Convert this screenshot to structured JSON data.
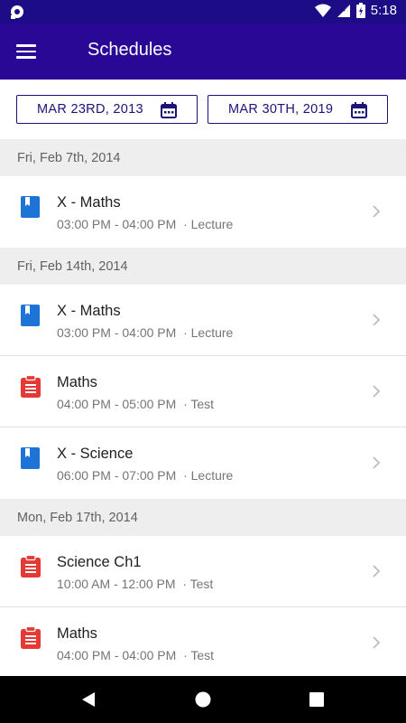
{
  "status_bar": {
    "time": "5:18",
    "icons": [
      "notification-icon",
      "wifi-icon",
      "signal-icon",
      "battery-icon"
    ]
  },
  "app_bar": {
    "title": "Schedules",
    "menu_icon": "menu-icon"
  },
  "date_range": {
    "start": "MAR 23RD, 2013",
    "end": "MAR 30TH, 2019"
  },
  "colors": {
    "status_bar": "#1c0c86",
    "app_bar": "#2a0896",
    "lecture_icon": "#1e74d6",
    "test_icon": "#e53935"
  },
  "sections": [
    {
      "date": "Fri, Feb 7th, 2014",
      "items": [
        {
          "title": "X - Maths",
          "time": "03:00 PM - 04:00 PM",
          "type": "Lecture",
          "icon": "book-icon"
        }
      ]
    },
    {
      "date": "Fri, Feb 14th, 2014",
      "items": [
        {
          "title": "X - Maths",
          "time": "03:00 PM - 04:00 PM",
          "type": "Lecture",
          "icon": "book-icon"
        },
        {
          "title": "Maths",
          "time": "04:00 PM - 05:00 PM",
          "type": "Test",
          "icon": "clipboard-icon"
        },
        {
          "title": "X - Science",
          "time": "06:00 PM - 07:00 PM",
          "type": "Lecture",
          "icon": "book-icon"
        }
      ]
    },
    {
      "date": "Mon, Feb 17th, 2014",
      "items": [
        {
          "title": "Science Ch1",
          "time": "10:00 AM - 12:00 PM",
          "type": "Test",
          "icon": "clipboard-icon"
        },
        {
          "title": "Maths",
          "time": "04:00 PM - 04:00 PM",
          "type": "Test",
          "icon": "clipboard-icon"
        }
      ]
    }
  ]
}
